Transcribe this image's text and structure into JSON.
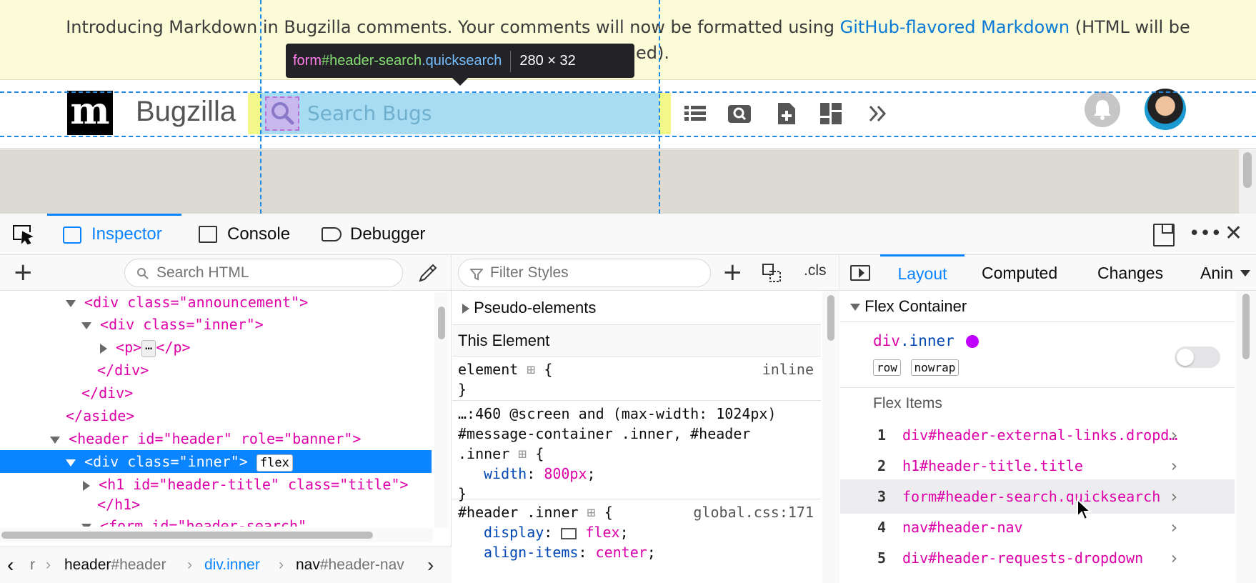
{
  "announcement": {
    "text_before": "Introducing Markdown in Bugzilla comments. Your comments will now be formatted using ",
    "link": "GitHub-flavored Markdown",
    "text_after_1": " (HTML will be",
    "text_after_2": "ed)."
  },
  "header": {
    "logo_letter": "m",
    "title": "Bugzilla",
    "search_placeholder": "Search Bugs"
  },
  "highlighter_tooltip": {
    "tag": "form",
    "id": "#header-search",
    "cls": ".quicksearch",
    "size": "280 × 32"
  },
  "devtools": {
    "tabs": [
      "Inspector",
      "Console",
      "Debugger"
    ],
    "html_search_placeholder": "Search HTML",
    "styles_filter_placeholder": "Filter Styles",
    "cls_label": ".cls",
    "sidebar_tabs": [
      "Layout",
      "Computed",
      "Changes",
      "Anin"
    ]
  },
  "markup": {
    "l1": "<div class=\"announcement\">",
    "l2": "<div class=\"inner\">",
    "l3_open": "<p>",
    "l3_ellipsis": "⋯",
    "l3_close": "</p>",
    "l4": "</div>",
    "l5": "</div>",
    "l6": "</aside>",
    "l7": "<header id=\"header\" role=\"banner\">",
    "l8": "<div class=\"inner\">",
    "l8_badge": "flex",
    "l9": "<h1 id=\"header-title\" class=\"title\">",
    "l10": "</h1>",
    "l11": "<form id=\"header-search\""
  },
  "breadcrumbs": {
    "first": "r",
    "b1_tag": "header",
    "b1_id": "#header",
    "b2_tag": "div",
    "b2_cls": ".inner",
    "b3_tag": "nav",
    "b3_id": "#header-nav"
  },
  "styles": {
    "pseudo": "Pseudo-elements",
    "this_element": "This Element",
    "r1_selector": "element",
    "r1_source": "inline",
    "r2_media": "…:460 @screen and (max-width: 1024px)",
    "r2_sel_a": "#message-container .inner, #header",
    "r2_sel_b": ".inner",
    "r2_prop": "width",
    "r2_val": "800px",
    "r3_selector": "#header .inner",
    "r3_source": "global.css:171",
    "r3_p1": "display",
    "r3_v1": "flex",
    "r3_p2": "align-items",
    "r3_v2": "center"
  },
  "layout": {
    "section": "Flex Container",
    "container_tag": "div",
    "container_cls": ".inner",
    "badge1": "row",
    "badge2": "nowrap",
    "items_title": "Flex Items",
    "items": [
      {
        "n": "1",
        "name": "div#header-external-links.dropd…"
      },
      {
        "n": "2",
        "name": "h1#header-title.title"
      },
      {
        "n": "3",
        "name": "form#header-search.quicksearch"
      },
      {
        "n": "4",
        "name": "nav#header-nav"
      },
      {
        "n": "5",
        "name": "div#header-requests-dropdown"
      }
    ]
  },
  "colors": {
    "accent": "#0a84ff",
    "tag_pink": "#dd00a9",
    "announce_bg": "#fbfbd8",
    "highlight_blue": "#a8dcf2",
    "highlight_yellow": "#f3f78a"
  }
}
